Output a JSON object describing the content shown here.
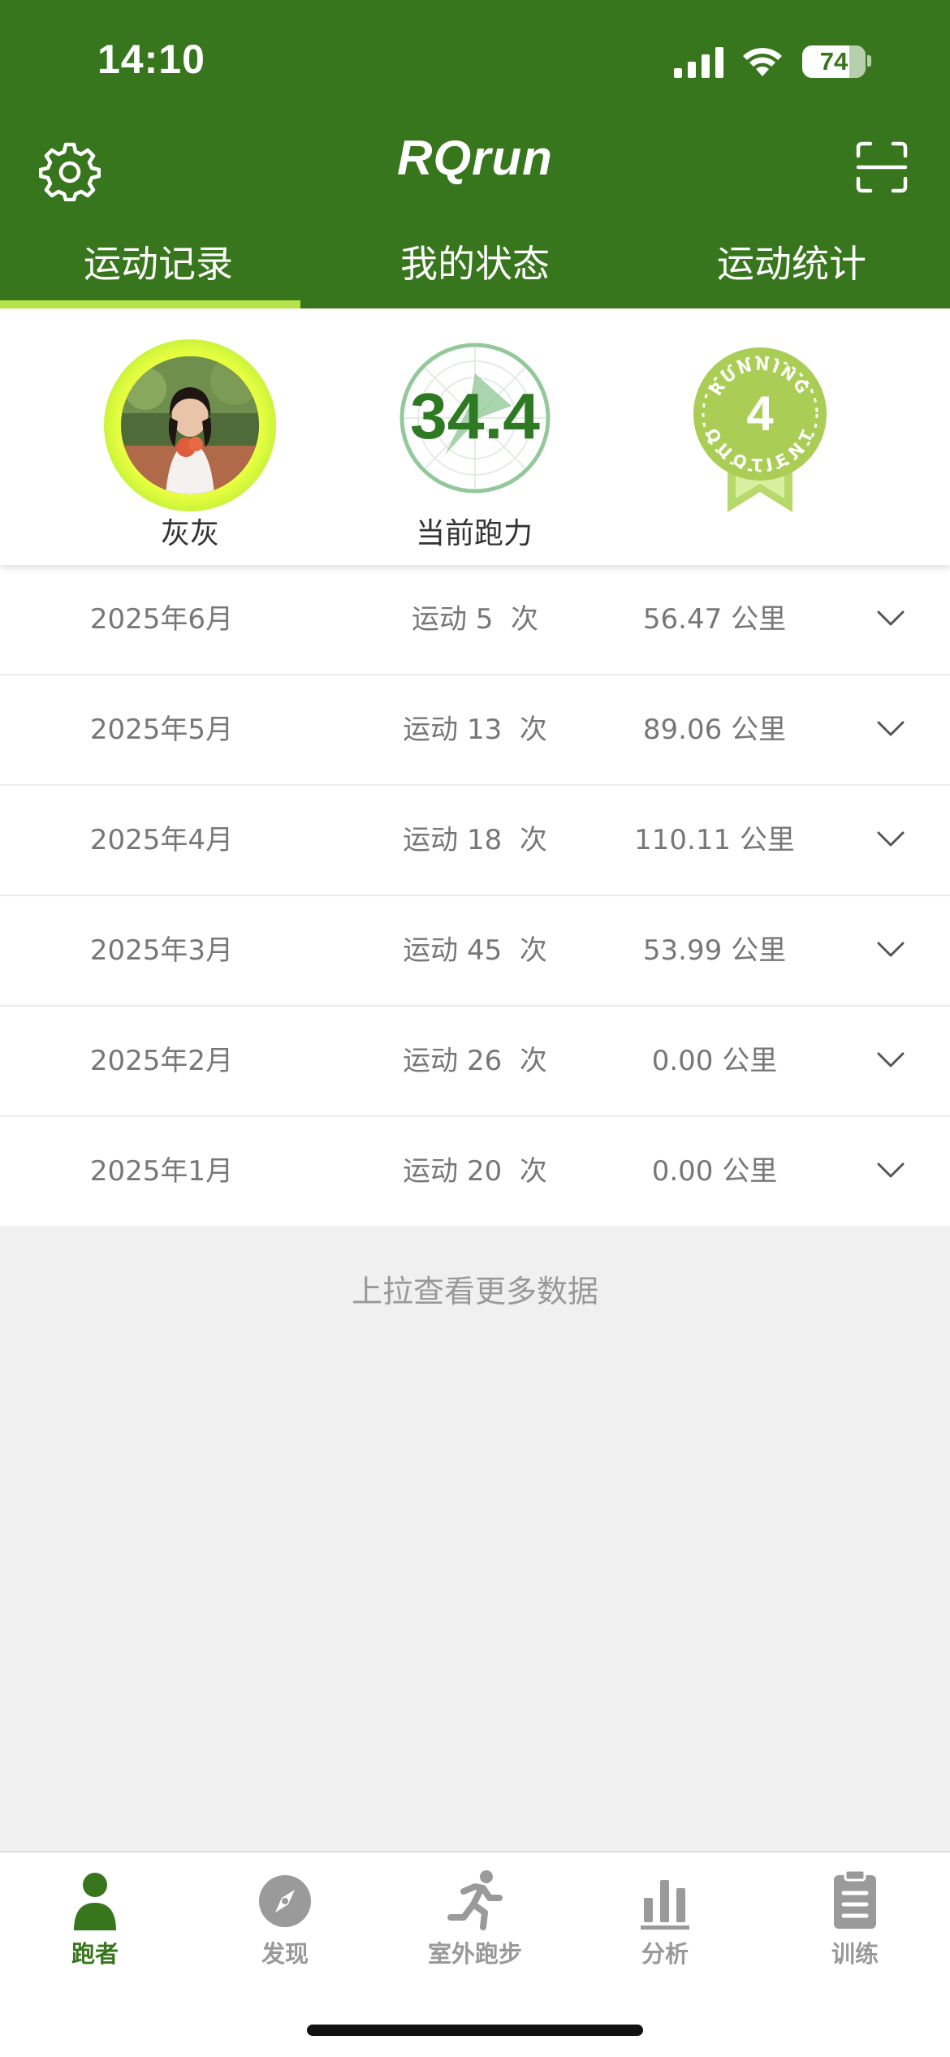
{
  "status_bar": {
    "time": "14:10",
    "battery_level": "74",
    "battery_fraction": 0.74,
    "signal_icon": "cellular-signal-icon",
    "wifi_icon": "wifi-icon"
  },
  "header": {
    "title": "RQrun",
    "settings_icon": "gear-icon",
    "scan_icon": "scan-icon",
    "background_color": "#38761d"
  },
  "tabs": [
    {
      "label": "运动记录",
      "active": true
    },
    {
      "label": "我的状态",
      "active": false
    },
    {
      "label": "运动统计",
      "active": false
    }
  ],
  "tab_indicator_color": "#b7e34a",
  "profile": {
    "name": "灰灰",
    "rq_value": "34.4",
    "rq_caption": "当前跑力",
    "badge_level": "4",
    "badge_text": "RUNNING QUOTIENT"
  },
  "records": [
    {
      "month": "2025年6月",
      "count_prefix": "运动",
      "count": "5",
      "count_suffix": "次",
      "distance": "56.47",
      "unit": "公里"
    },
    {
      "month": "2025年5月",
      "count_prefix": "运动",
      "count": "13",
      "count_suffix": "次",
      "distance": "89.06",
      "unit": "公里"
    },
    {
      "month": "2025年4月",
      "count_prefix": "运动",
      "count": "18",
      "count_suffix": "次",
      "distance": "110.11",
      "unit": "公里"
    },
    {
      "month": "2025年3月",
      "count_prefix": "运动",
      "count": "45",
      "count_suffix": "次",
      "distance": "53.99",
      "unit": "公里"
    },
    {
      "month": "2025年2月",
      "count_prefix": "运动",
      "count": "26",
      "count_suffix": "次",
      "distance": "0.00",
      "unit": "公里"
    },
    {
      "month": "2025年1月",
      "count_prefix": "运动",
      "count": "20",
      "count_suffix": "次",
      "distance": "0.00",
      "unit": "公里"
    }
  ],
  "load_more": "上拉查看更多数据",
  "tabbar": [
    {
      "label": "跑者",
      "icon": "person-icon",
      "active": true
    },
    {
      "label": "发现",
      "icon": "compass-icon",
      "active": false
    },
    {
      "label": "室外跑步",
      "icon": "runner-icon",
      "active": false
    },
    {
      "label": "分析",
      "icon": "bar-chart-icon",
      "active": false
    },
    {
      "label": "训练",
      "icon": "clipboard-icon",
      "active": false
    }
  ],
  "accent_color": "#38761d"
}
